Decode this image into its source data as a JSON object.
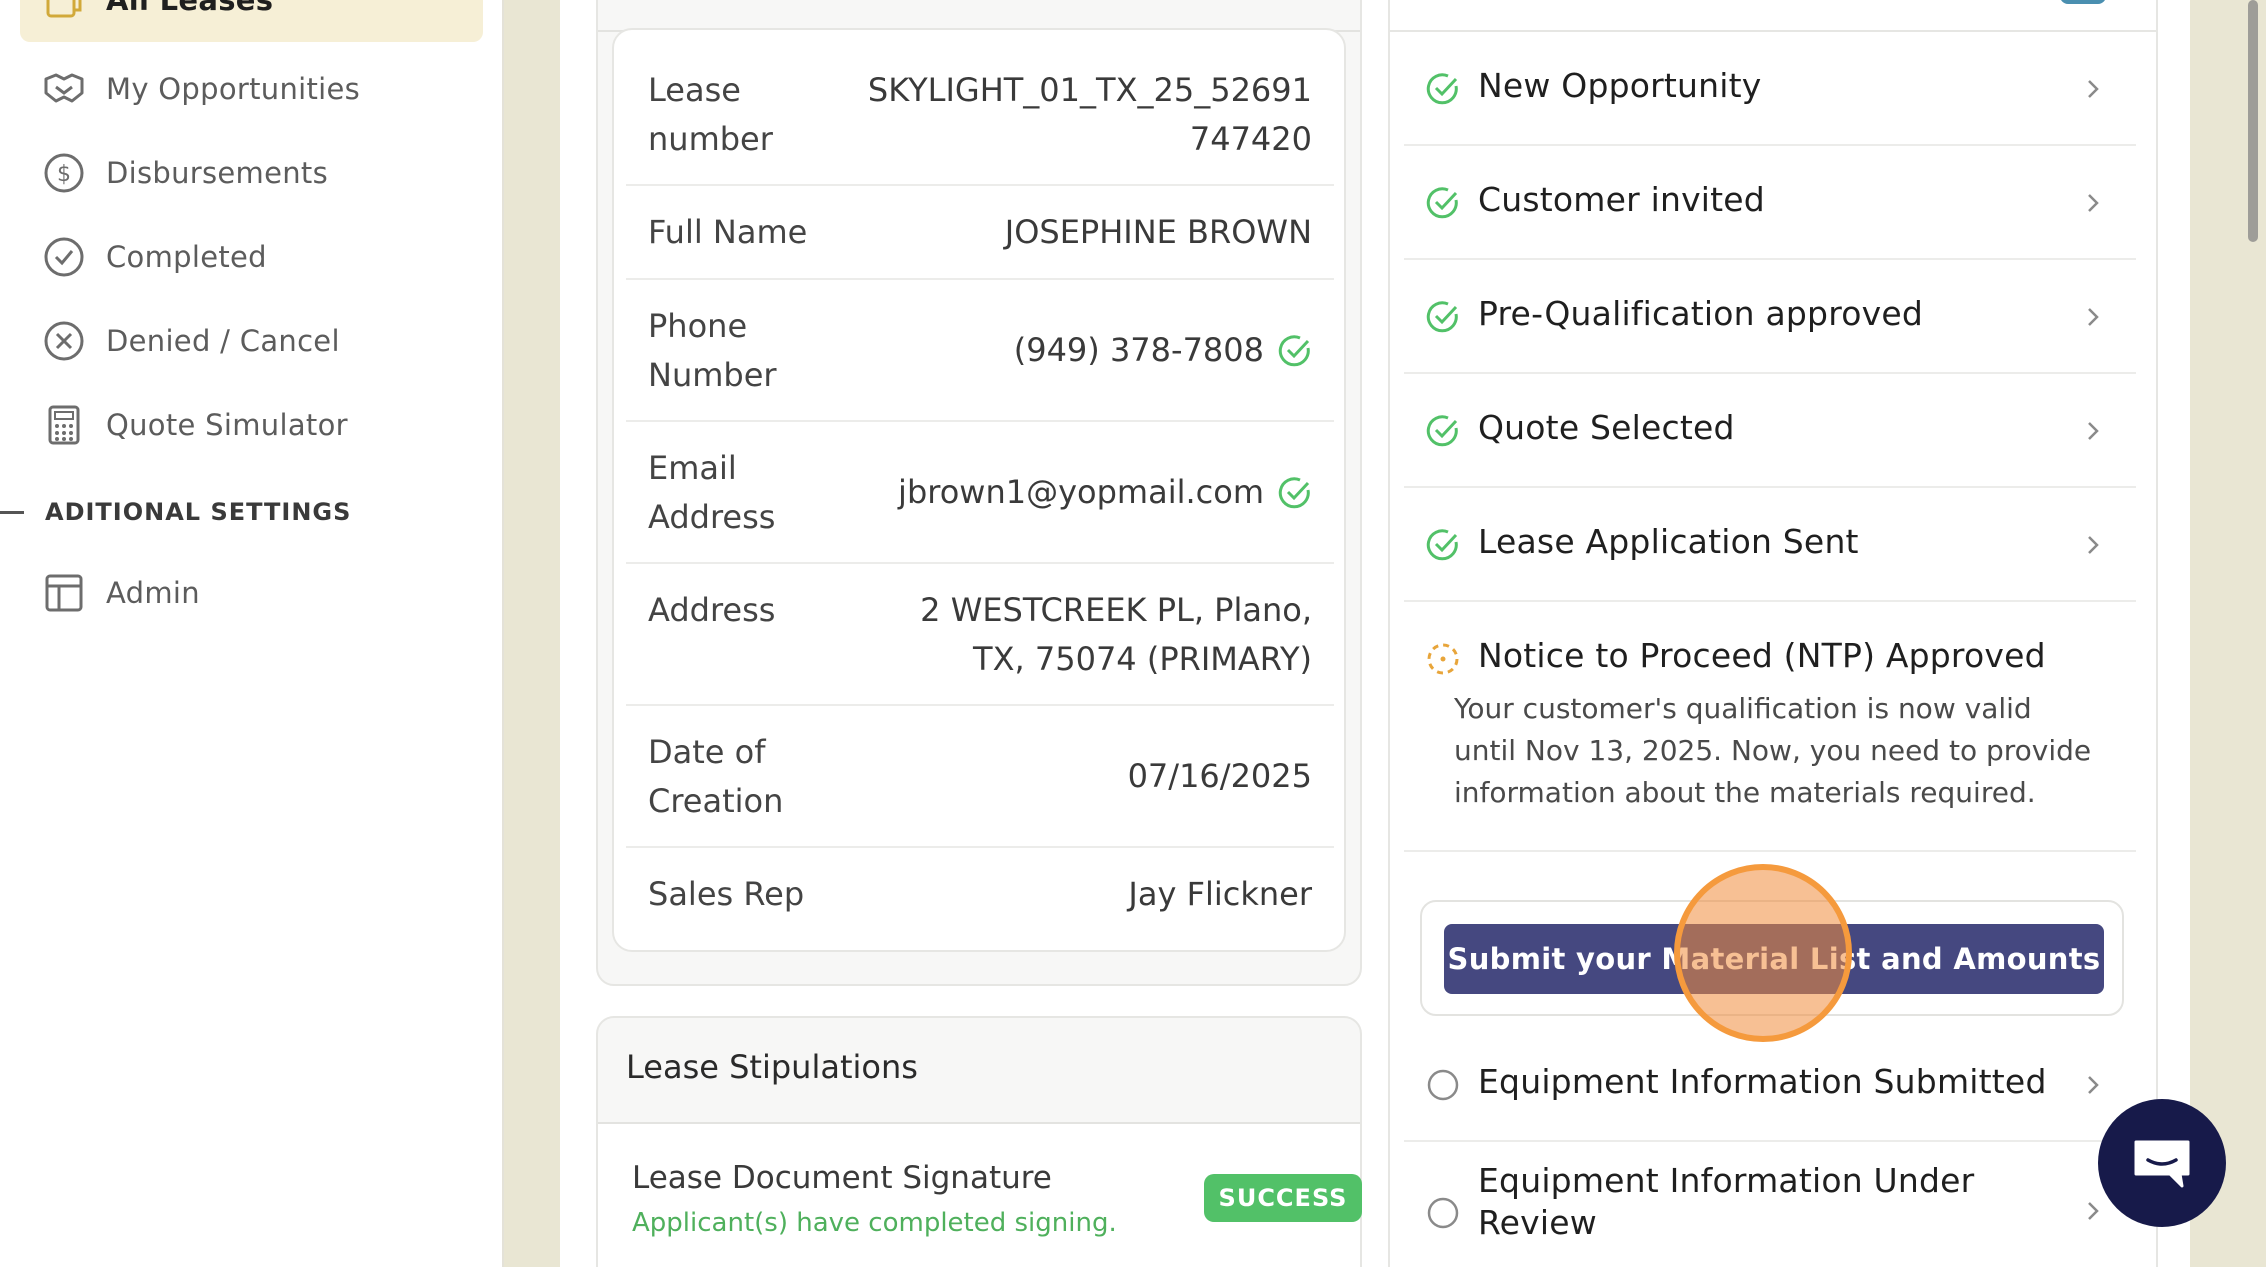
{
  "sidebar": {
    "items": [
      {
        "label": "All Leases",
        "icon": "leases-icon",
        "active": true
      },
      {
        "label": "My Opportunities",
        "icon": "handshake-icon"
      },
      {
        "label": "Disbursements",
        "icon": "dollar-circle-icon"
      },
      {
        "label": "Completed",
        "icon": "check-circle-icon"
      },
      {
        "label": "Denied / Cancel",
        "icon": "x-circle-icon"
      },
      {
        "label": "Quote Simulator",
        "icon": "calculator-icon"
      }
    ],
    "section_title": "ADITIONAL SETTINGS",
    "settings_items": [
      {
        "label": "Admin",
        "icon": "layout-icon"
      }
    ]
  },
  "details": {
    "rows": [
      {
        "label": "Lease number",
        "value_lines": [
          "SKYLIGHT_01_TX_25_52691",
          "747420"
        ]
      },
      {
        "label": "Full Name",
        "value": "JOSEPHINE BROWN"
      },
      {
        "label": "Phone Number",
        "value": "(949) 378-7808",
        "verified": true
      },
      {
        "label": "Email Address",
        "value": "jbrown1@yopmail.com",
        "verified": true
      },
      {
        "label": "Address",
        "value_lines": [
          "2 WESTCREEK PL, Plano,",
          "TX, 75074 (PRIMARY)"
        ]
      },
      {
        "label": "Date of Creation",
        "value": "07/16/2025"
      },
      {
        "label": "Sales Rep",
        "value": "Jay Flickner"
      }
    ]
  },
  "stipulations": {
    "title": "Lease Stipulations",
    "items": [
      {
        "name": "Lease Document Signature",
        "detail": "Applicant(s) have completed signing.",
        "status": "SUCCESS"
      }
    ]
  },
  "steps": {
    "completed": [
      "New Opportunity",
      "Customer invited",
      "Pre-Qualification approved",
      "Quote Selected",
      "Lease Application Sent"
    ],
    "current": {
      "label": "Notice to Proceed (NTP) Approved",
      "description": "Your customer's qualification is now valid until Nov 13, 2025. Now, you need to provide information about the materials required.",
      "action": "Submit your Material List and Amounts"
    },
    "pending": [
      "Equipment Information Submitted",
      "Equipment Information Under Review"
    ]
  },
  "colors": {
    "accent_green": "#52c168",
    "button": "#454880",
    "pending_orange": "#e8a53a",
    "chat_bubble": "#171a4a"
  }
}
